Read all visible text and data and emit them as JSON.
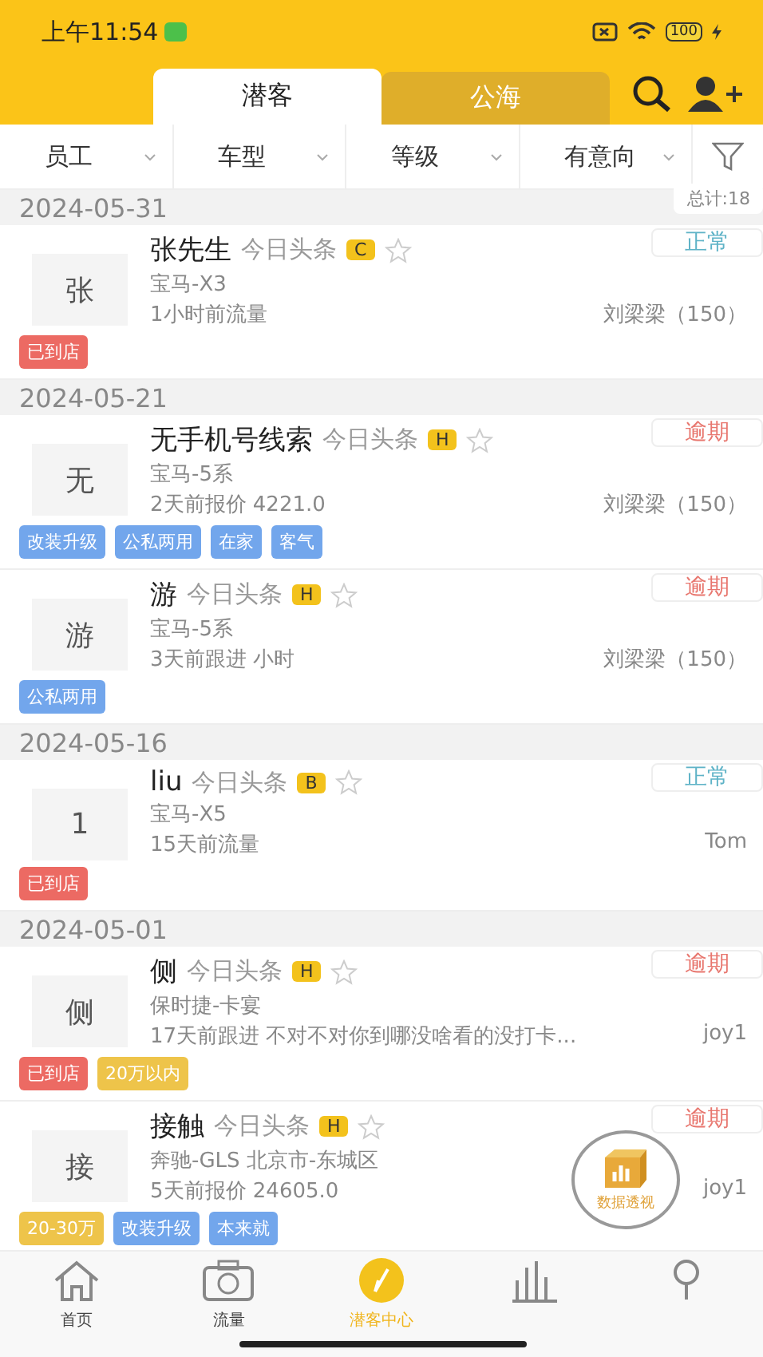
{
  "status_bar": {
    "time": "上午11:54",
    "battery": "100"
  },
  "tabs": [
    {
      "label": "潜客",
      "selected": true
    },
    {
      "label": "公海",
      "selected": false
    }
  ],
  "filters": [
    {
      "label": "员工",
      "kind": "dropdown"
    },
    {
      "label": "车型",
      "kind": "dropdown"
    },
    {
      "label": "等级",
      "kind": "dropdown"
    },
    {
      "label": "有意向",
      "kind": "dropdown"
    },
    {
      "kind": "filter"
    }
  ],
  "total": "总计:18",
  "groups": [
    {
      "date": "2024-05-31",
      "customers": [
        {
          "avatar": "张",
          "name": "张先生",
          "source": "今日头条",
          "grade": "C",
          "car": "宝马-X3",
          "info": "1小时前流量",
          "agent": "刘梁梁（150）",
          "status": {
            "label": "正常",
            "color": "#5fb3c7"
          },
          "tags": [
            {
              "label": "已到店",
              "color": "#ec6a63"
            }
          ]
        }
      ]
    },
    {
      "date": "2024-05-21",
      "customers": [
        {
          "avatar": "无",
          "name": "无手机号线索",
          "source": "今日头条",
          "grade": "H",
          "car": "宝马-5系",
          "info": "2天前报价  4221.0",
          "agent": "刘梁梁（150）",
          "status": {
            "label": "逾期",
            "color": "#e8776f"
          },
          "tags": [
            {
              "label": "改装升级",
              "color": "#72a6ec"
            },
            {
              "label": "公私两用",
              "color": "#72a6ec"
            },
            {
              "label": "在家",
              "color": "#72a6ec"
            },
            {
              "label": "客气",
              "color": "#72a6ec"
            }
          ]
        },
        {
          "avatar": "游",
          "name": "游",
          "source": "今日头条",
          "grade": "H",
          "car": "宝马-5系",
          "info": "3天前跟进  小时",
          "agent": "刘梁梁（150）",
          "status": {
            "label": "逾期",
            "color": "#e8776f"
          },
          "tags": [
            {
              "label": "公私两用",
              "color": "#72a6ec"
            }
          ]
        }
      ]
    },
    {
      "date": "2024-05-16",
      "customers": [
        {
          "avatar": "1",
          "name": "liu",
          "source": "今日头条",
          "grade": "B",
          "car": "宝马-X5",
          "info": "15天前流量",
          "agent": "Tom",
          "status": {
            "label": "正常",
            "color": "#5fb3c7"
          },
          "tags": [
            {
              "label": "已到店",
              "color": "#ec6a63"
            }
          ]
        }
      ]
    },
    {
      "date": "2024-05-01",
      "customers": [
        {
          "avatar": "侧",
          "name": "侧",
          "source": "今日头条",
          "grade": "H",
          "car": "保时捷-卡宴",
          "info": "17天前跟进  不对不对你到哪没啥看的没打卡...",
          "agent": "joy1",
          "status": {
            "label": "逾期",
            "color": "#e8776f"
          },
          "tags": [
            {
              "label": "已到店",
              "color": "#ec6a63"
            },
            {
              "label": "20万以内",
              "color": "#eec44a"
            }
          ]
        },
        {
          "avatar": "接",
          "name": "接触",
          "source": "今日头条",
          "grade": "H",
          "car": "奔驰-GLS  北京市-东城区",
          "info": "5天前报价  24605.0",
          "agent": "joy1",
          "status": {
            "label": "逾期",
            "color": "#e8776f"
          },
          "tags": [
            {
              "label": "20-30万",
              "color": "#eec44a"
            },
            {
              "label": "改装升级",
              "color": "#72a6ec"
            },
            {
              "label": "本来就",
              "color": "#72a6ec"
            }
          ]
        }
      ]
    }
  ],
  "float_button": {
    "label": "数据透视"
  },
  "nav": [
    {
      "label": "首页",
      "kind": "home",
      "selected": false
    },
    {
      "label": "流量",
      "kind": "camera",
      "selected": false
    },
    {
      "label": "潜客中心",
      "kind": "compass",
      "selected": true
    },
    {
      "kind": "chart",
      "selected": false
    },
    {
      "kind": "pin",
      "selected": false
    }
  ]
}
